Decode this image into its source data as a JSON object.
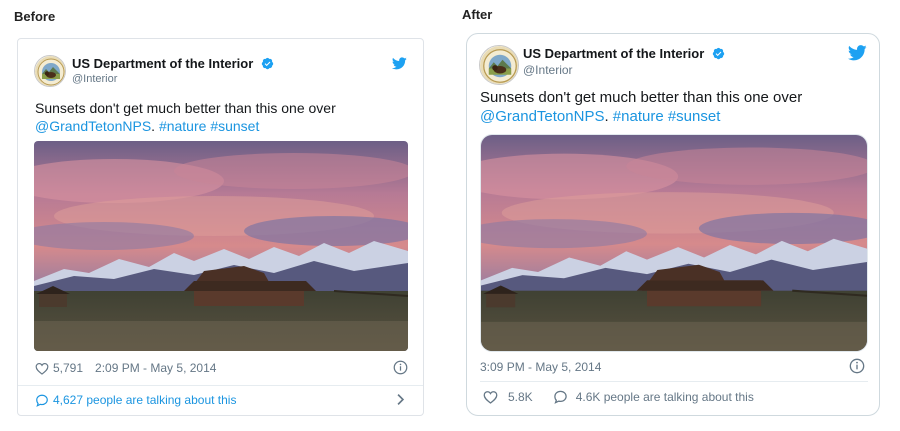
{
  "labels": {
    "before": "Before",
    "after": "After"
  },
  "tweet": {
    "account_name": "US Department of the Interior",
    "handle": "@Interior",
    "text_plain": "Sunsets don't get much better than this one over",
    "mention": "@GrandTetonNPS",
    "text_separator": ". ",
    "hashtags": [
      "#nature",
      "#sunset"
    ]
  },
  "before": {
    "likes": "5,791",
    "timestamp": "2:09 PM - May 5, 2014",
    "talking": "4,627 people are talking about this"
  },
  "after": {
    "timestamp": "3:09 PM - May 5, 2014",
    "likes": "5.8K",
    "talking": "4.6K people are talking about this"
  },
  "colors": {
    "link": "#1b95e0",
    "verified": "#1da1f2",
    "twitter_blue": "#1da1f2",
    "muted_text": "#657786"
  },
  "icons": [
    "seal-avatar",
    "verified-badge-icon",
    "twitter-bird-icon",
    "heart-icon",
    "info-icon",
    "comment-bubble-icon",
    "chevron-right-icon"
  ]
}
